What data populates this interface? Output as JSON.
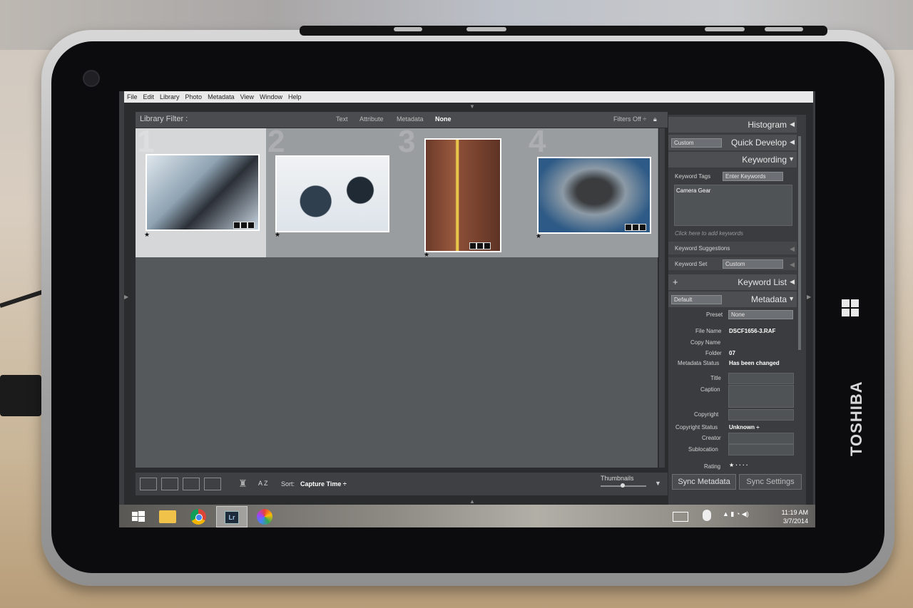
{
  "device": {
    "brand": "TOSHIBA"
  },
  "menu": [
    "File",
    "Edit",
    "Library",
    "Photo",
    "Metadata",
    "View",
    "Window",
    "Help"
  ],
  "library_filter": {
    "label": "Library Filter :",
    "options": [
      "Text",
      "Attribute",
      "Metadata",
      "None"
    ],
    "active": "None",
    "filters_off": "Filters Off ÷"
  },
  "grid": {
    "cells": [
      {
        "number": "1",
        "selected": true,
        "rating": "★"
      },
      {
        "number": "2",
        "selected": false,
        "rating": "★"
      },
      {
        "number": "3",
        "selected": false,
        "rating": "★"
      },
      {
        "number": "4",
        "selected": false,
        "rating": "★"
      }
    ]
  },
  "toolbar": {
    "sort_label": "Sort:",
    "sort_value": "Capture Time ÷",
    "thumbnails_label": "Thumbnails",
    "sort_icon_text": "A Z"
  },
  "right_panel": {
    "histogram": "Histogram",
    "quick_develop": "Quick Develop",
    "quick_develop_preset": "Custom",
    "keywording": "Keywording",
    "keyword_tags_label": "Keyword Tags",
    "keyword_tags_mode": "Enter Keywords",
    "keywords_value": "Camera Gear",
    "add_keywords_placeholder": "Click here to add keywords",
    "keyword_suggestions": "Keyword Suggestions",
    "keyword_set_label": "Keyword Set",
    "keyword_set_value": "Custom",
    "keyword_list": "Keyword List",
    "keyword_list_add": "+",
    "metadata": "Metadata",
    "metadata_preset_selector": "Default",
    "preset_label": "Preset",
    "preset_value": "None",
    "file_name_label": "File Name",
    "file_name_value": "DSCF1656-3.RAF",
    "copy_name_label": "Copy Name",
    "folder_label": "Folder",
    "folder_value": "07",
    "metadata_status_label": "Metadata Status",
    "metadata_status_value": "Has been changed",
    "title_label": "Title",
    "caption_label": "Caption",
    "copyright_label": "Copyright",
    "copyright_status_label": "Copyright Status",
    "copyright_status_value": "Unknown ÷",
    "creator_label": "Creator",
    "sublocation_label": "Sublocation",
    "rating_label": "Rating",
    "rating_value": "★ · · · ·",
    "sync_metadata": "Sync Metadata",
    "sync_settings": "Sync Settings"
  },
  "taskbar": {
    "time": "11:19 AM",
    "date": "3/7/2014",
    "lr_label": "Lr"
  },
  "colors": {
    "accent": "#ffffff",
    "panel": "#3a3c3f",
    "grid_bg": "#56595c"
  }
}
